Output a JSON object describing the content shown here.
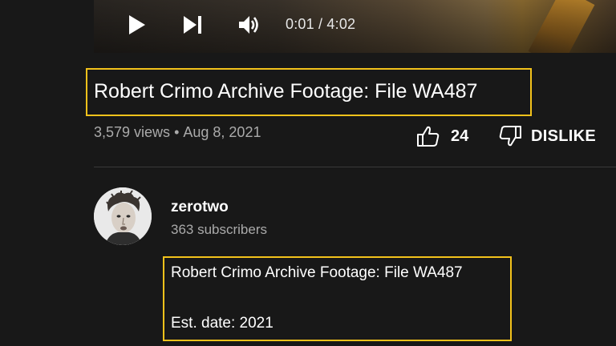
{
  "player": {
    "time_display": "0:01 / 4:02",
    "controls": {
      "play_icon": "play-icon",
      "next_icon": "skip-next-icon",
      "volume_icon": "volume-icon"
    }
  },
  "video": {
    "title": "Robert Crimo Archive Footage: File WA487",
    "views": "3,579 views",
    "separator": "•",
    "date": "Aug 8, 2021",
    "likes": "24",
    "dislike_label": "DISLIKE"
  },
  "channel": {
    "name": "zerotwo",
    "subscribers": "363 subscribers"
  },
  "description": {
    "line1": "Robert Crimo Archive Footage: File WA487",
    "line2": "Est. date: 2021"
  },
  "colors": {
    "background": "#181818",
    "highlight_box": "#f3c21b",
    "secondary_text": "#aaaaaa"
  }
}
